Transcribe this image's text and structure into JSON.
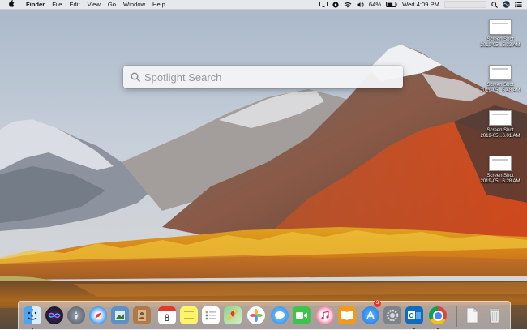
{
  "menubar": {
    "app_name": "Finder",
    "items": [
      "File",
      "Edit",
      "View",
      "Go",
      "Window",
      "Help"
    ],
    "status": {
      "battery": "64%",
      "clock": "Wed 4:09 PM",
      "icons": [
        "screen-mirror-icon",
        "dropbox-icon",
        "wifi-icon",
        "volume-icon",
        "battery-icon",
        "user-account-box",
        "search-icon",
        "siri-icon",
        "notification-center-icon"
      ]
    }
  },
  "spotlight": {
    "placeholder": "Spotlight Search"
  },
  "desktop_icons": [
    {
      "name": "Screen Shot",
      "date": "2019-05...5.33 AM"
    },
    {
      "name": "Screen Shot",
      "date": "2019-05...5.48 AM"
    },
    {
      "name": "Screen Shot",
      "date": "2019-05...6.01 AM"
    },
    {
      "name": "Screen Shot",
      "date": "2019-05...6.28 AM"
    }
  ],
  "dock": {
    "apps": [
      "finder",
      "siri",
      "launchpad",
      "safari",
      "preview",
      "notes-book",
      "calendar",
      "stickies",
      "reminders",
      "maps",
      "photos",
      "messages",
      "facetime",
      "itunes",
      "ibooks",
      "app-store",
      "system-preferences",
      "outlook",
      "chrome",
      "document",
      "trash"
    ],
    "calendar_day": "8",
    "app_store_badge": "3"
  }
}
